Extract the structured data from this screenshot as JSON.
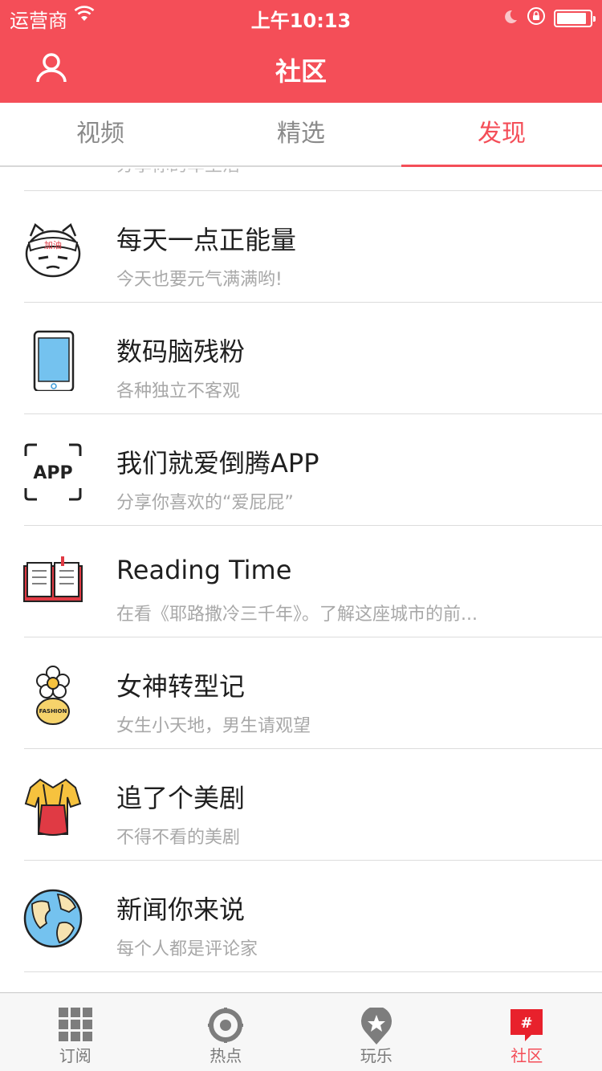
{
  "status_bar": {
    "carrier": "运营商",
    "time": "上午10:13",
    "battery_level": 0.92
  },
  "nav": {
    "title": "社区",
    "user_icon": "user-icon"
  },
  "tabs": [
    {
      "label": "视频",
      "active": false
    },
    {
      "label": "精选",
      "active": false
    },
    {
      "label": "发现",
      "active": true
    }
  ],
  "list": {
    "peek_text": "分享你的车生活",
    "items": [
      {
        "name": "每天一点正能量",
        "desc": "今天也要元气满满哟!",
        "icon": "cheer-cat-icon",
        "badge": "加油"
      },
      {
        "name": "数码脑残粉",
        "desc": "各种独立不客观",
        "icon": "tablet-icon"
      },
      {
        "name": "我们就爱倒腾APP",
        "desc": "分享你喜欢的“爱屁屁”",
        "icon": "app-frame-icon",
        "badge": "APP"
      },
      {
        "name": "Reading Time",
        "desc": "在看《耶路撒冷三千年》。了解这座城市的前...",
        "icon": "open-book-icon"
      },
      {
        "name": "女神转型记",
        "desc": "女生小天地，男生请观望",
        "icon": "fashion-flower-icon",
        "badge": "FASHION"
      },
      {
        "name": "追了个美剧",
        "desc": "不得不看的美剧",
        "icon": "costume-icon"
      },
      {
        "name": "新闻你来说",
        "desc": "每个人都是评论家",
        "icon": "globe-icon"
      }
    ]
  },
  "tabbar": [
    {
      "label": "订阅",
      "icon": "grid-icon",
      "active": false
    },
    {
      "label": "热点",
      "icon": "target-icon",
      "active": false
    },
    {
      "label": "玩乐",
      "icon": "location-star-icon",
      "active": false
    },
    {
      "label": "社区",
      "icon": "hash-bubble-icon",
      "badge": "#",
      "active": true
    }
  ],
  "colors": {
    "accent": "#f44e58",
    "text": "#1f1f1f",
    "muted": "#a8a8a8"
  }
}
